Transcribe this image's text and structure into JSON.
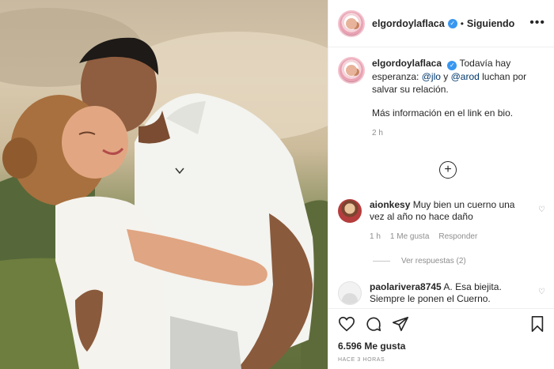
{
  "post": {
    "username": "elgordoylaflaca",
    "separator": "•",
    "follow_status": "Siguiendo",
    "more_label": "•••",
    "caption": {
      "username": "elgordoylaflaca",
      "text_part1": "Todavía hay esperanza:",
      "mention1": "@jlo",
      "text_part2": "y",
      "mention2": "@arod",
      "text_part3": "luchan por salvar su relación.",
      "paragraph2": "Más información en el link en bio.",
      "time": "2 h"
    },
    "load_more_label": "+",
    "comments": [
      {
        "username": "aionkesy",
        "text": "Muy bien un cuerno una vez al año no hace daño",
        "time": "1 h",
        "likes": "1 Me gusta",
        "reply": "Responder",
        "view_replies": "Ver respuestas (2)"
      },
      {
        "username": "paolarivera8745",
        "text": "A. Esa biejita. Siempre le ponen el Cuerno."
      }
    ],
    "likes_count": "6.596 Me gusta",
    "posted_ago": "HACE 3 HORAS"
  },
  "colors": {
    "verified": "#3897f0",
    "mention": "#00376b",
    "muted": "#8e8e8e"
  }
}
